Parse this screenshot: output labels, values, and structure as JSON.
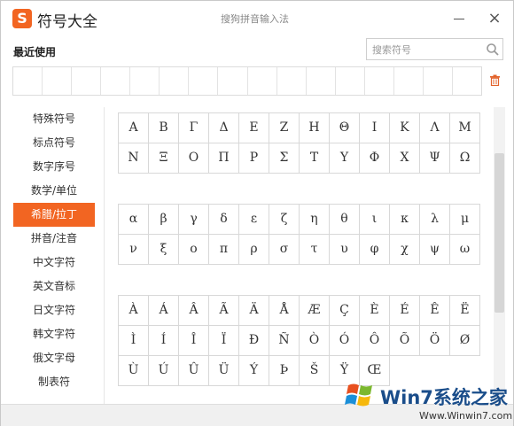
{
  "window": {
    "logo_letter": "S",
    "app_title": "符号大全",
    "subtitle": "搜狗拼音输入法",
    "close_glyph": "×"
  },
  "recent": {
    "label": "最近使用",
    "cells": 16
  },
  "search": {
    "placeholder": "搜索符号"
  },
  "sidebar": {
    "items": [
      {
        "label": "特殊符号",
        "active": false
      },
      {
        "label": "标点符号",
        "active": false
      },
      {
        "label": "数字序号",
        "active": false
      },
      {
        "label": "数学/单位",
        "active": false
      },
      {
        "label": "希腊/拉丁",
        "active": true
      },
      {
        "label": "拼音/注音",
        "active": false
      },
      {
        "label": "中文字符",
        "active": false
      },
      {
        "label": "英文音标",
        "active": false
      },
      {
        "label": "日文字符",
        "active": false
      },
      {
        "label": "韩文字符",
        "active": false
      },
      {
        "label": "俄文字母",
        "active": false
      },
      {
        "label": "制表符",
        "active": false
      }
    ]
  },
  "symbol_groups": [
    [
      "Α",
      "Β",
      "Γ",
      "Δ",
      "Ε",
      "Ζ",
      "Η",
      "Θ",
      "Ι",
      "Κ",
      "Λ",
      "Μ",
      "Ν",
      "Ξ",
      "Ο",
      "Π",
      "Ρ",
      "Σ",
      "Τ",
      "Υ",
      "Φ",
      "Χ",
      "Ψ",
      "Ω"
    ],
    [
      "α",
      "β",
      "γ",
      "δ",
      "ε",
      "ζ",
      "η",
      "θ",
      "ι",
      "κ",
      "λ",
      "μ",
      "ν",
      "ξ",
      "ο",
      "π",
      "ρ",
      "σ",
      "τ",
      "υ",
      "φ",
      "χ",
      "ψ",
      "ω"
    ],
    [
      "À",
      "Á",
      "Â",
      "Ã",
      "Ä",
      "Å",
      "Æ",
      "Ç",
      "È",
      "É",
      "Ê",
      "Ë",
      "Ì",
      "Í",
      "Î",
      "Ï",
      "Ð",
      "Ñ",
      "Ò",
      "Ó",
      "Ô",
      "Õ",
      "Ö",
      "Ø",
      "Ù",
      "Ú",
      "Û",
      "Ü",
      "Ý",
      "Þ",
      "Š",
      "Ÿ",
      "Œ"
    ]
  ],
  "watermark": {
    "brand": "Win7系统之家",
    "url": "Www.Winwin7.com"
  },
  "colors": {
    "accent": "#f26522"
  }
}
